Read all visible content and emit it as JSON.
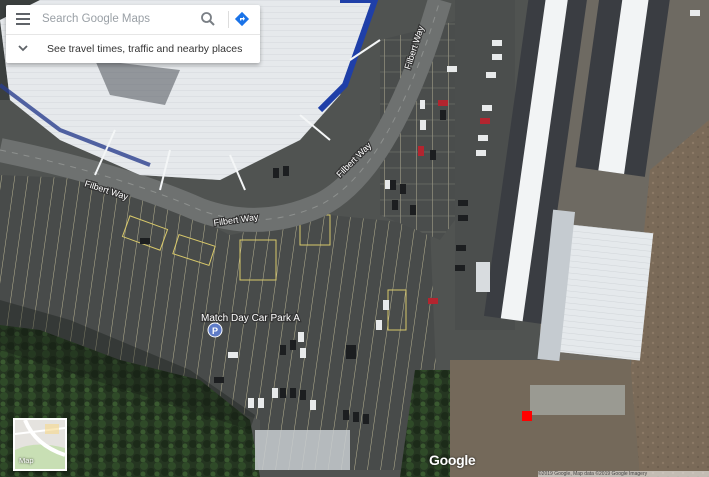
{
  "search": {
    "placeholder": "Search Google Maps",
    "travel_text": "See travel times, traffic and nearby places"
  },
  "icons": {
    "menu": "hamburger-menu-icon",
    "search": "magnifier-search-icon",
    "directions": "directions-diamond-icon",
    "expand": "chevron-down-icon",
    "poi": "parking-pin-icon"
  },
  "map": {
    "view": "satellite",
    "roads": [
      {
        "id": "filbert-way-1",
        "label": "Filbert Way"
      },
      {
        "id": "filbert-way-2",
        "label": "Filbert Way"
      },
      {
        "id": "filbert-way-3",
        "label": "Filbert Way"
      },
      {
        "id": "filbert-way-4",
        "label": "Filbert Way"
      }
    ],
    "poi": {
      "label": "Match Day Car Park A",
      "symbol": "P"
    },
    "marker_color": "#ff0000"
  },
  "colors": {
    "accent_blue": "#1a73e8",
    "label_text": "#ffffff",
    "poi_pin": "#5e7bc7"
  },
  "map_type": {
    "label": "Map"
  },
  "branding": {
    "logo": "Google",
    "attribution": "©2019 Google, Map data ©2019 Google Imagery"
  }
}
